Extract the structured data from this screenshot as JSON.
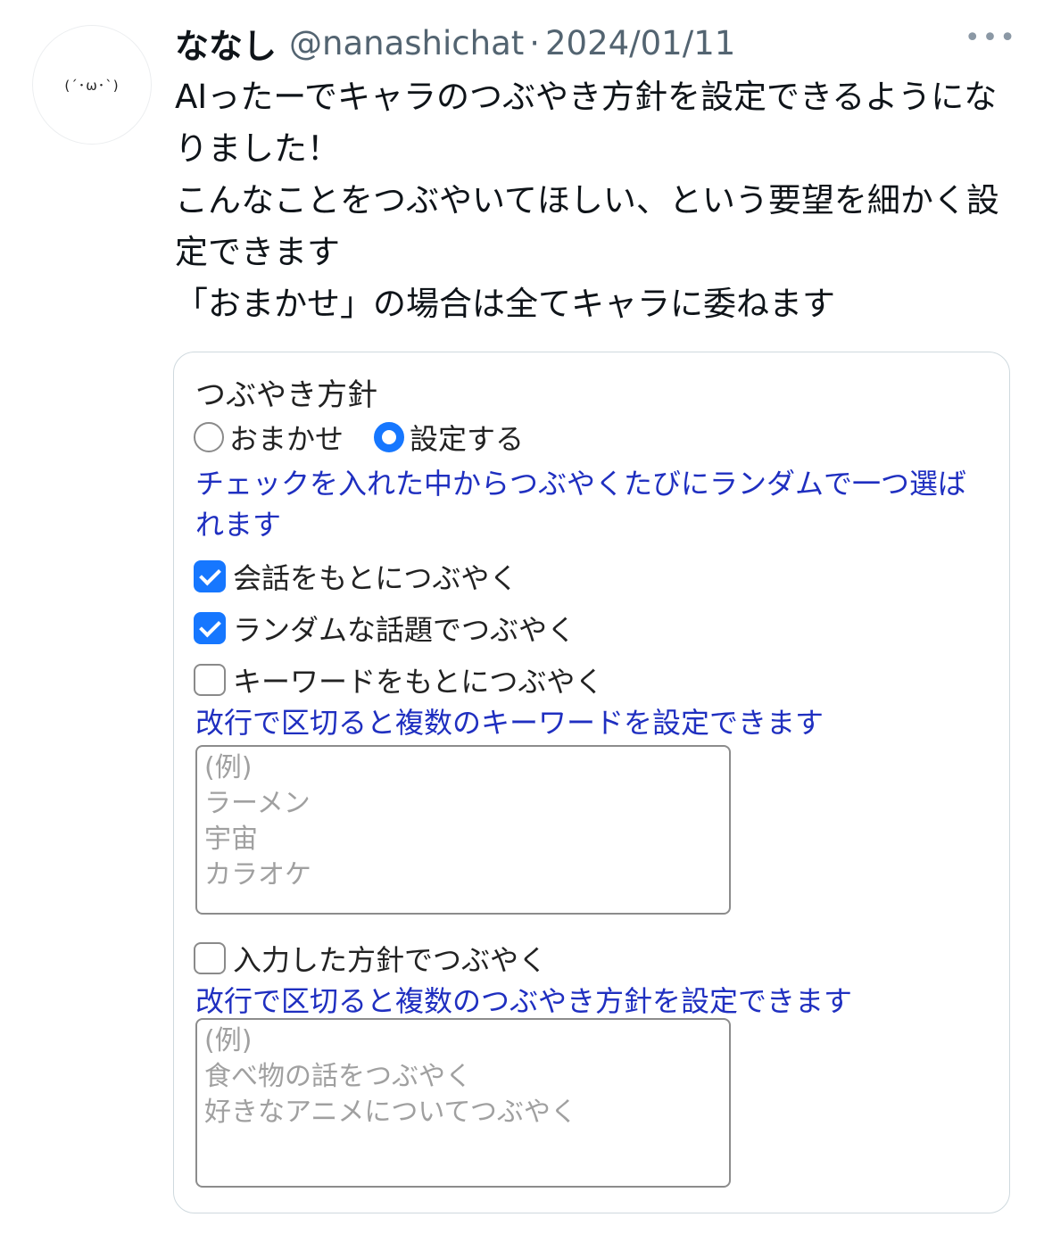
{
  "tweet": {
    "avatar_text": "(´･ω･`)",
    "display_name": "ななし",
    "handle": "@nanashichat",
    "separator": "·",
    "date": "2024/01/11",
    "more_icon": "•••",
    "text": "AIったーでキャラのつぶやき方針を設定できるようになりました！\nこんなことをつぶやいてほしい、という要望を細かく設定できます\n「おまかせ」の場合は全てキャラに委ねます"
  },
  "card": {
    "title": "つぶやき方針",
    "radios": [
      {
        "label": "おまかせ",
        "checked": false
      },
      {
        "label": "設定する",
        "checked": true
      }
    ],
    "hint_random": "チェックを入れた中からつぶやくたびにランダムで一つ選ばれます",
    "options": [
      {
        "label": "会話をもとにつぶやく",
        "checked": true
      },
      {
        "label": "ランダムな話題でつぶやく",
        "checked": true
      },
      {
        "label": "キーワードをもとにつぶやく",
        "checked": false
      },
      {
        "label": "入力した方針でつぶやく",
        "checked": false
      }
    ],
    "keyword_hint": "改行で区切ると複数のキーワードを設定できます",
    "keyword_placeholder": "(例)\nラーメン\n宇宙\nカラオケ",
    "policy_hint": "改行で区切ると複数のつぶやき方針を設定できます",
    "policy_placeholder": "(例)\n食べ物の話をつぶやく\n好きなアニメについてつぶやく"
  },
  "colors": {
    "accent": "#1677ff",
    "hint_text": "#1f2fc0",
    "secondary_text": "#536471"
  }
}
